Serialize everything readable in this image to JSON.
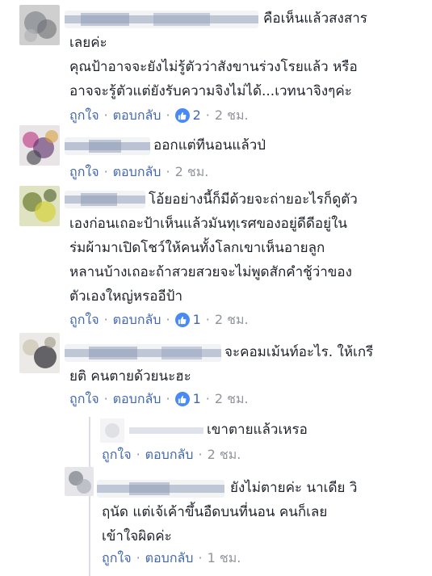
{
  "labels": {
    "like": "ถูกใจ",
    "reply": "ตอบกลับ",
    "dot": "·"
  },
  "comments": [
    {
      "lines": [
        "คือเห็นแล้วสงสาร",
        "เลยค่ะ",
        "คุณป้าอาจจะยังไม่รู้ตัวว่าสังขานร่วงโรยแล้ว หรือ",
        "อาจจะรู้ตัวแต่ยังรับความจิงไม่ได้...เวทนาจิงๆค่ะ"
      ],
      "like_count": "2",
      "time": "2 ชม."
    },
    {
      "lines": [
        "ออกแต่ทีนอนแล้วป่"
      ],
      "time": "2 ชม."
    },
    {
      "lines": [
        "โอ้ยอย่างนี้ก็มีด้วยจะถ่ายอะไรก็ดูตัว",
        "เองก่อนเถอะป้าเห็นแล้วมันทุเรศของอยู่ดีดีอยู่ใน",
        "ร่มผ้ามาเปิดโชว์ให้คนทั้งโลกเขาเห็นอายลูก",
        "หลานบ้างเถอะถ้าสวยสวยจะไม่พูดสักคำชู้ว่าของ",
        "ตัวเองใหญ่หรออีป้า"
      ],
      "like_count": "1",
      "time": "2 ชม."
    },
    {
      "lines": [
        "จะคอมเม้นท์อะไร. ให้เกรี",
        "ยติ คนตายด้วยนะฮะ"
      ],
      "like_count": "1",
      "time": "2 ชม."
    }
  ],
  "replies": [
    {
      "lines": [
        "เขาตายแล้วเหรอ"
      ],
      "time": "2 ชม."
    },
    {
      "lines": [
        "ยังไม่ตายค่ะ นาเดีย วิ",
        "ฤนัด แต่เจ้เค้าขึ้นอืดบนที่นอน คนก็เลย",
        "เข้าใจผิดค่ะ"
      ],
      "time": "1 ชม."
    }
  ],
  "colors": {
    "link": "#4267b2",
    "meta": "#90949c",
    "text": "#1d2129",
    "like_icon": "#4a8af4"
  }
}
